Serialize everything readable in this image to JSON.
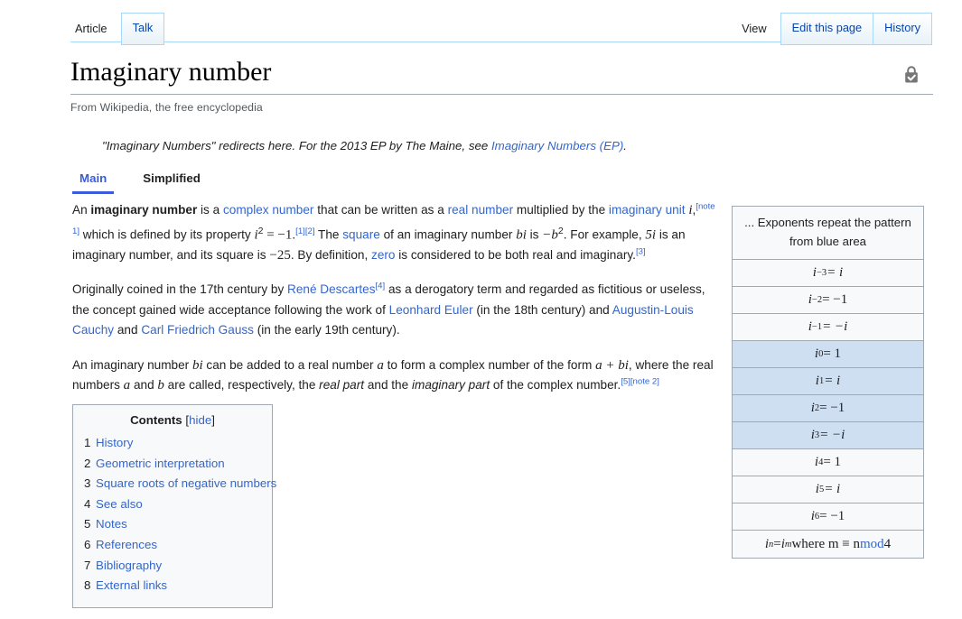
{
  "namespace_tabs": [
    {
      "label": "Article",
      "style": "plain",
      "active": true
    },
    {
      "label": "Talk",
      "style": "boxed",
      "active": false
    }
  ],
  "action_tabs": [
    {
      "label": "View",
      "style": "plain",
      "active": true
    },
    {
      "label": "Edit this page",
      "style": "boxed",
      "active": false
    },
    {
      "label": "History",
      "style": "boxed",
      "active": false
    }
  ],
  "article": {
    "title": "Imaginary number",
    "tagline": "From Wikipedia, the free encyclopedia",
    "protection_icon": "padlock-check-icon"
  },
  "hatnote": {
    "text_before": "\"Imaginary Numbers\" redirects here. For the 2013 EP by The Maine, see ",
    "link": "Imaginary Numbers (EP)",
    "text_after": "."
  },
  "view_tabs": [
    {
      "label": "Main",
      "active": true
    },
    {
      "label": "Simplified",
      "active": false
    }
  ],
  "paragraphs": {
    "p1": {
      "s1": "An ",
      "bold": "imaginary number",
      "s2": " is a ",
      "l1": "complex number",
      "s3": " that can be written as a ",
      "l2": "real number",
      "s4": " multiplied by the ",
      "l3": "imaginary unit",
      "s5": " ",
      "math1": "i",
      "s6": ",",
      "note1": "[note 1]",
      "s7": " which is defined by its property ",
      "math2": "i",
      "exp2": "2",
      "math3": " = −1",
      "s8": ".",
      "ref1": "[1]",
      "ref2": "[2]",
      "s9": " The ",
      "l4": "square",
      "s10": " of an imaginary number ",
      "math4": "bi",
      "s11": " is ",
      "math5": "−b",
      "exp5": "2",
      "s12": ". For example, ",
      "math6": "5i",
      "s13": " is an imaginary number, and its square is ",
      "math7": "−25",
      "s14": ". By definition, ",
      "l5": "zero",
      "s15": " is considered to be both real and imaginary.",
      "ref3": "[3]"
    },
    "p2": {
      "s1": "Originally coined in the 17th century by ",
      "l1": "René Descartes",
      "ref4": "[4]",
      "s2": " as a derogatory term and regarded as fictitious or useless, the concept gained wide acceptance following the work of ",
      "l2": "Leonhard Euler",
      "s3": " (in the 18th century) and ",
      "l3": "Augustin-Louis Cauchy",
      "s4": " and ",
      "l4": "Carl Friedrich Gauss",
      "s5": " (in the early 19th century)."
    },
    "p3": {
      "s1": "An imaginary number ",
      "math1": "bi",
      "s2": " can be added to a real number ",
      "math2": "a",
      "s3": " to form a complex number of the form ",
      "math3": "a + bi",
      "s4": ", where the real numbers ",
      "math4": "a",
      "s5": " and ",
      "math5": "b",
      "s6": " are called, respectively, the ",
      "em1": "real part",
      "s7": " and the ",
      "em2": "imaginary part",
      "s8": " of the complex number.",
      "ref5": "[5]",
      "note2": "[note 2]"
    }
  },
  "toc": {
    "title": "Contents",
    "bracket_open": "[",
    "hide_label": "hide",
    "bracket_close": "]",
    "items": [
      {
        "num": "1",
        "label": "History"
      },
      {
        "num": "2",
        "label": "Geometric interpretation"
      },
      {
        "num": "3",
        "label": "Square roots of negative numbers"
      },
      {
        "num": "4",
        "label": "See also"
      },
      {
        "num": "5",
        "label": "Notes"
      },
      {
        "num": "6",
        "label": "References"
      },
      {
        "num": "7",
        "label": "Bibliography"
      },
      {
        "num": "8",
        "label": "External links"
      }
    ]
  },
  "powers_table": {
    "header_line1": "... Exponents repeat the pattern",
    "header_line2": "from blue area",
    "highlight_color": "#cedff2",
    "rows": [
      {
        "base": "i",
        "exp": "−3",
        "rhs": "= i",
        "highlight": false
      },
      {
        "base": "i",
        "exp": "−2",
        "rhs": "= −1",
        "highlight": false
      },
      {
        "base": "i",
        "exp": "−1",
        "rhs": "= −i",
        "highlight": false
      },
      {
        "base": "i",
        "exp": "0",
        "rhs": "= 1",
        "highlight": true
      },
      {
        "base": "i",
        "exp": "1",
        "rhs": "= i",
        "highlight": true
      },
      {
        "base": "i",
        "exp": "2",
        "rhs": "= −1",
        "highlight": true
      },
      {
        "base": "i",
        "exp": "3",
        "rhs": "= −i",
        "highlight": true
      },
      {
        "base": "i",
        "exp": "4",
        "rhs": "= 1",
        "highlight": false
      },
      {
        "base": "i",
        "exp": "5",
        "rhs": "= i",
        "highlight": false
      },
      {
        "base": "i",
        "exp": "6",
        "rhs": "= −1",
        "highlight": false
      }
    ],
    "footer": {
      "base1": "i",
      "exp1": "n",
      "eq": "= ",
      "base2": "i",
      "exp2": "m",
      "where": " where m ≡ n ",
      "mod_link": "mod",
      "tail": " 4"
    }
  }
}
